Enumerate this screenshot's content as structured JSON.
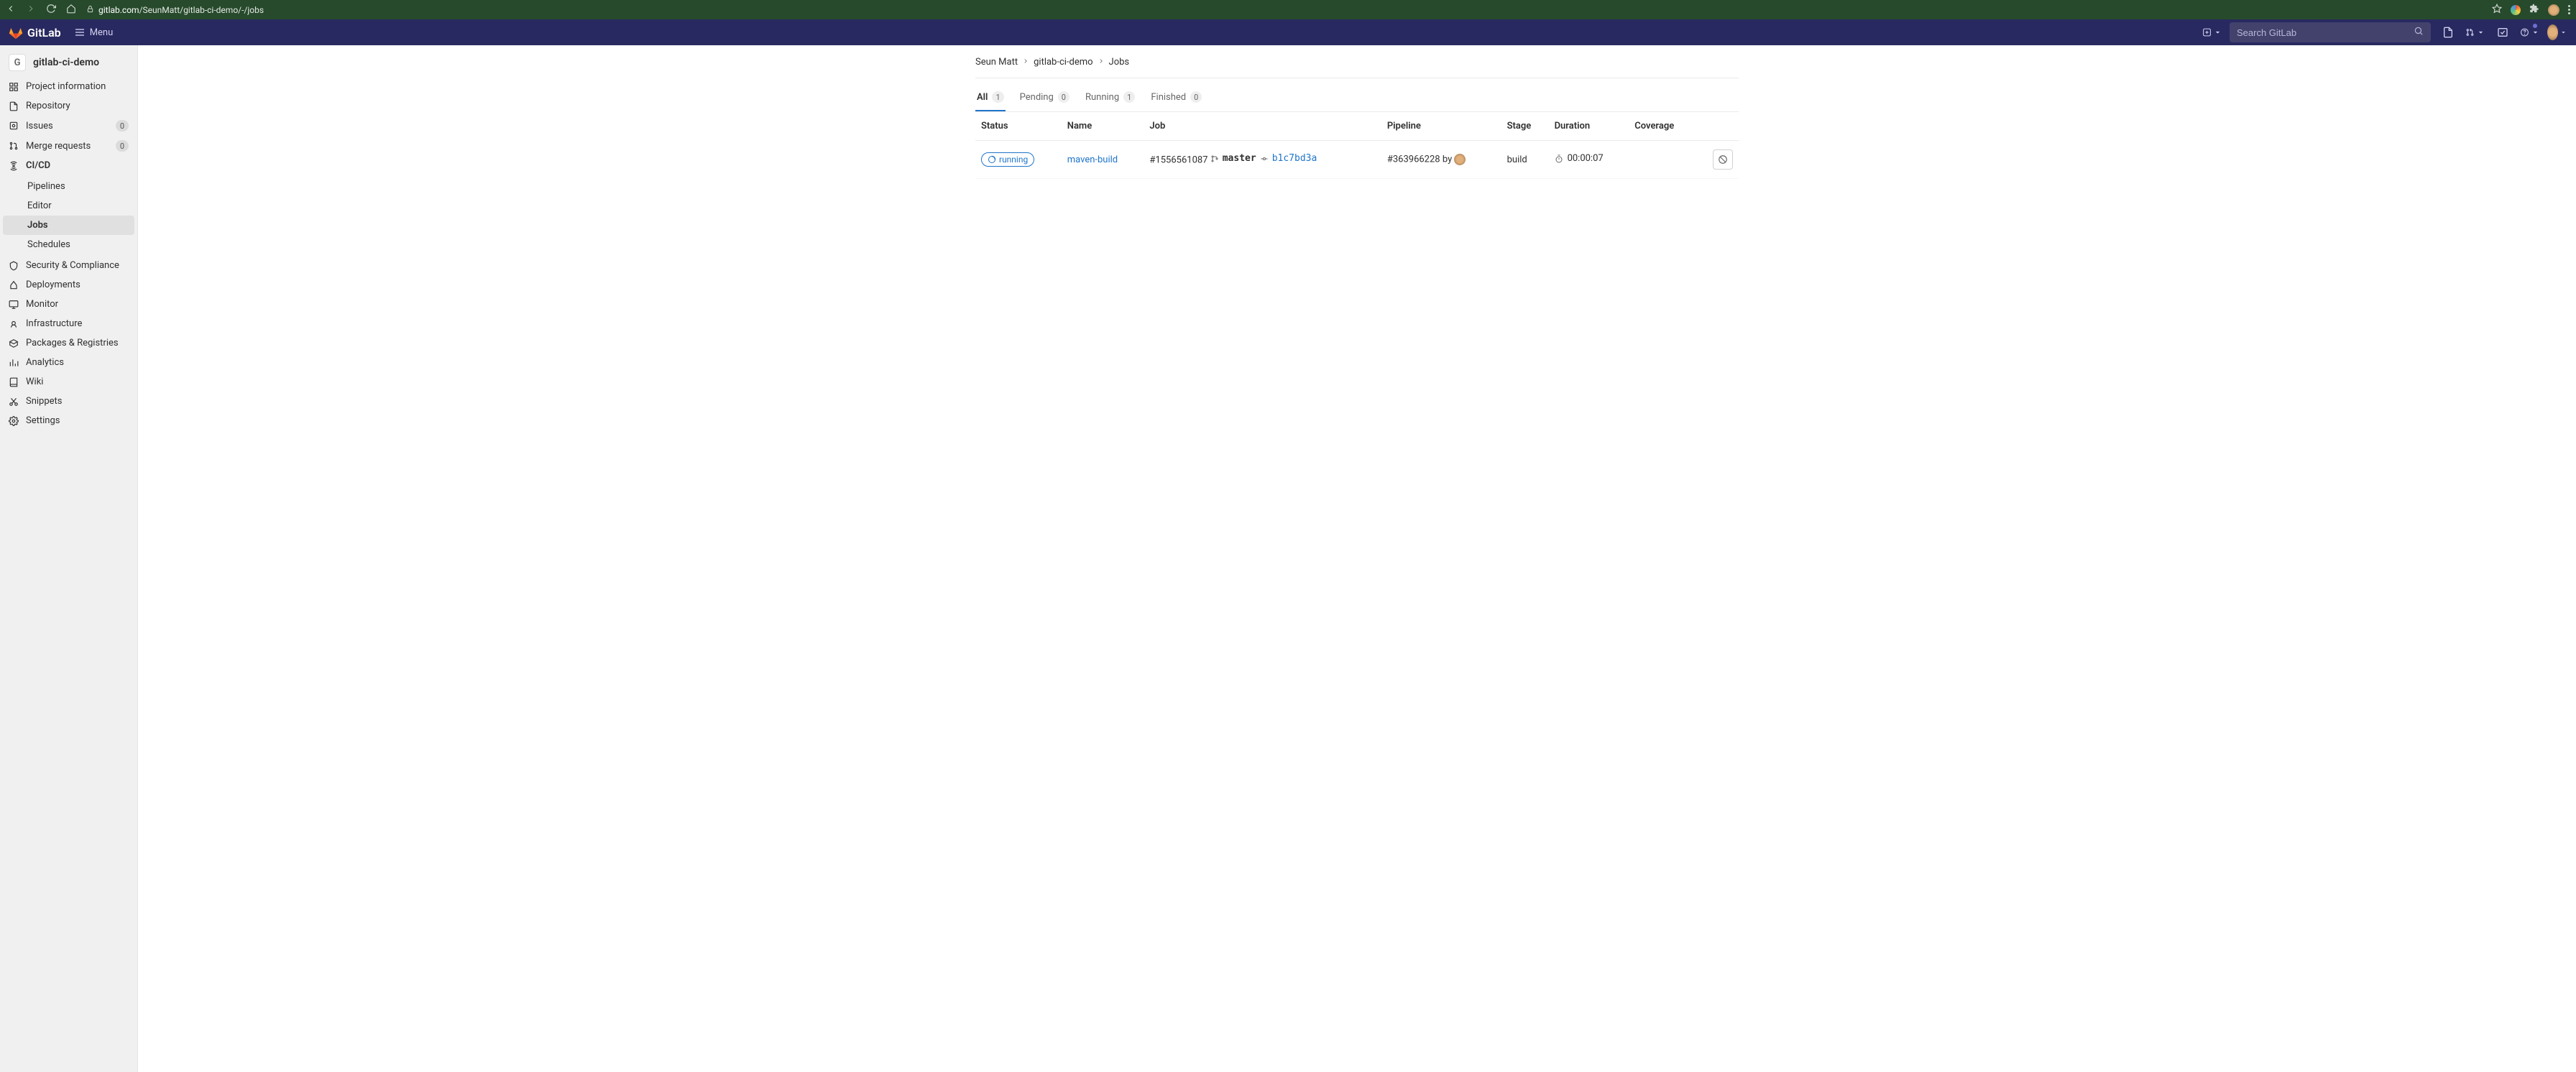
{
  "browser": {
    "url_host": "gitlab.com",
    "url_path": "/SeunMatt/gitlab-ci-demo/-/jobs"
  },
  "header": {
    "brand": "GitLab",
    "menu_label": "Menu",
    "search_placeholder": "Search GitLab"
  },
  "project": {
    "initial": "G",
    "name": "gitlab-ci-demo"
  },
  "sidebar": {
    "project_information": "Project information",
    "repository": "Repository",
    "issues": "Issues",
    "issues_count": "0",
    "merge_requests": "Merge requests",
    "mr_count": "0",
    "cicd": "CI/CD",
    "cicd_children": {
      "pipelines": "Pipelines",
      "editor": "Editor",
      "jobs": "Jobs",
      "schedules": "Schedules"
    },
    "security": "Security & Compliance",
    "deployments": "Deployments",
    "monitor": "Monitor",
    "infrastructure": "Infrastructure",
    "packages": "Packages & Registries",
    "analytics": "Analytics",
    "wiki": "Wiki",
    "snippets": "Snippets",
    "settings": "Settings"
  },
  "breadcrumbs": {
    "owner": "Seun Matt",
    "project": "gitlab-ci-demo",
    "page": "Jobs"
  },
  "tabs": {
    "all": "All",
    "all_count": "1",
    "pending": "Pending",
    "pending_count": "0",
    "running": "Running",
    "running_count": "1",
    "finished": "Finished",
    "finished_count": "0"
  },
  "table": {
    "headers": {
      "status": "Status",
      "name": "Name",
      "job": "Job",
      "pipeline": "Pipeline",
      "stage": "Stage",
      "duration": "Duration",
      "coverage": "Coverage"
    },
    "row": {
      "status_label": "running",
      "name": "maven-build",
      "job_id": "#1556561087",
      "branch": "master",
      "commit": "b1c7bd3a",
      "pipeline_id": "#363966228",
      "pipeline_by": "by",
      "stage": "build",
      "duration": "00:00:07"
    }
  }
}
